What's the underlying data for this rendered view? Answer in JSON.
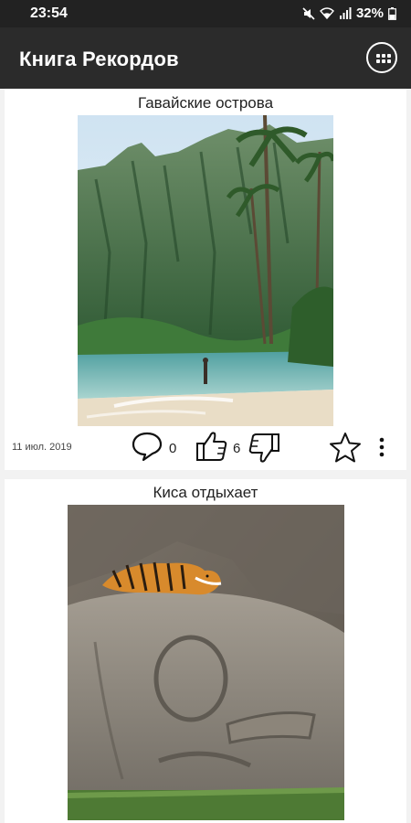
{
  "status_bar": {
    "time": "23:54",
    "battery": "32%",
    "icons": [
      "mute-icon",
      "wifi-icon",
      "signal-icon",
      "battery-icon"
    ]
  },
  "app_bar": {
    "title": "Книга Рекордов",
    "menu_icon": "grid-menu-icon"
  },
  "posts": [
    {
      "title": "Гавайские острова",
      "date": "11 июл. 2019",
      "comments_count": "0",
      "likes_count": "6",
      "image": "tropical-beach-photo"
    },
    {
      "title": "Киса отдыхает",
      "image": "tiger-on-stone-head-photo"
    }
  ],
  "colors": {
    "status_bar": "#222222",
    "app_bar": "#2b2b2b",
    "background": "#f2f2f2",
    "card": "#ffffff"
  }
}
